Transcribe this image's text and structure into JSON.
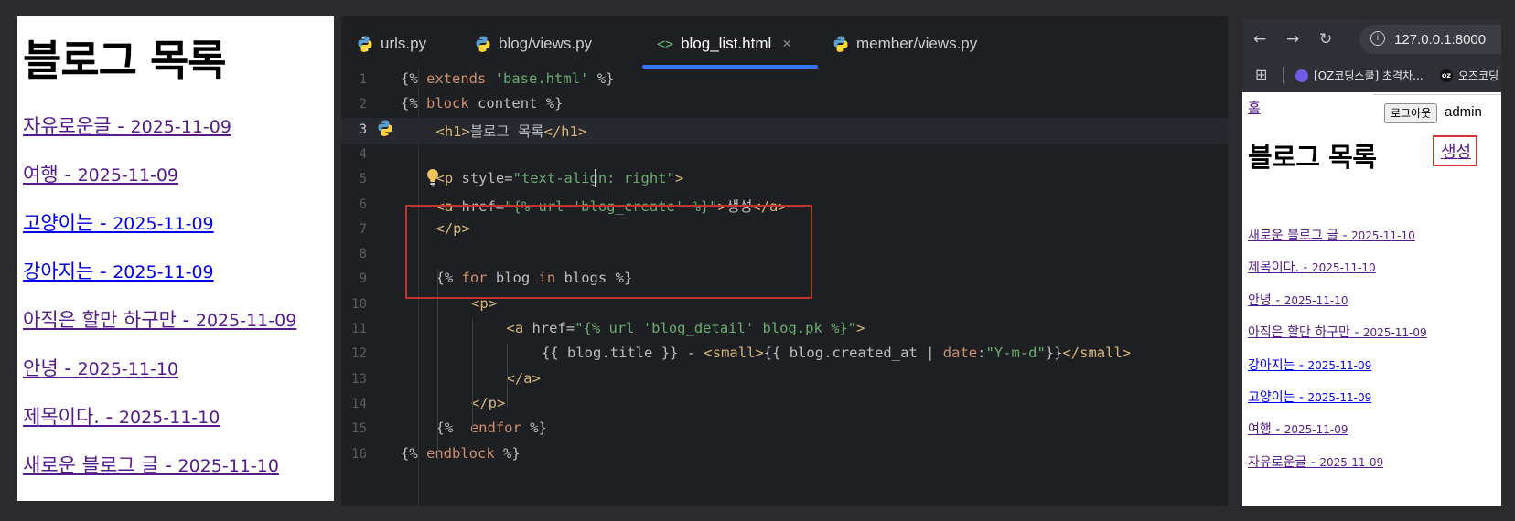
{
  "left_browser": {
    "heading": "블로그 목록",
    "posts": [
      {
        "title": "자유로운글",
        "date": "2025-11-09",
        "visited": true
      },
      {
        "title": "여행",
        "date": "2025-11-09",
        "visited": true
      },
      {
        "title": "고양이는",
        "date": "2025-11-09",
        "visited": false
      },
      {
        "title": "강아지는",
        "date": "2025-11-09",
        "visited": false
      },
      {
        "title": "아직은 할만 하구만",
        "date": "2025-11-09",
        "visited": true
      },
      {
        "title": "안녕",
        "date": "2025-11-10",
        "visited": true
      },
      {
        "title": "제목이다.",
        "date": "2025-11-10",
        "visited": true
      },
      {
        "title": "새로운 블로그 글",
        "date": "2025-11-10",
        "visited": true
      }
    ],
    "separator": " - "
  },
  "editor": {
    "tabs": [
      {
        "label": "urls.py",
        "icon": "python-icon",
        "active": false
      },
      {
        "label": "blog/views.py",
        "icon": "python-icon",
        "active": false
      },
      {
        "label": "blog_list.html",
        "icon": "html-icon",
        "active": true
      },
      {
        "label": "member/views.py",
        "icon": "python-icon",
        "active": false
      }
    ],
    "html_icon_glyph": "<>",
    "close_glyph": "×",
    "current_line": 3,
    "lines": [
      {
        "n": "1",
        "text": "{% extends 'base.html' %}"
      },
      {
        "n": "2",
        "text": "{% block content %}"
      },
      {
        "n": "3",
        "text": "<h1>블로그 목록</h1>"
      },
      {
        "n": "4",
        "text": ""
      },
      {
        "n": "5",
        "text": "<p style=\"text-align: right\">"
      },
      {
        "n": "6",
        "text": "<a href=\"{% url 'blog_create' %}\">생성</a>"
      },
      {
        "n": "7",
        "text": "</p>"
      },
      {
        "n": "8",
        "text": ""
      },
      {
        "n": "9",
        "text": "{% for blog in blogs %}"
      },
      {
        "n": "10",
        "text": "<p>"
      },
      {
        "n": "11",
        "text": "<a href=\"{% url 'blog_detail' blog.pk %}\">"
      },
      {
        "n": "12",
        "text": "{{ blog.title }} - <small>{{ blog.created_at | date:\"Y-m-d\"}}</small>"
      },
      {
        "n": "13",
        "text": "</a>"
      },
      {
        "n": "14",
        "text": "</p>"
      },
      {
        "n": "15",
        "text": "{%  endfor %}"
      },
      {
        "n": "16",
        "text": "{% endblock %}"
      }
    ],
    "colors": {
      "keyword": "#cf8e6d",
      "string": "#6aab73",
      "tag": "#d5b778",
      "highlight_box": "#c0352b",
      "accent": "#3574f0"
    }
  },
  "right_browser": {
    "url": "127.0.0.1:8000",
    "bookmarks": [
      {
        "label": "[OZ코딩스쿨] 초격차...",
        "icon": "oz-school-favicon"
      },
      {
        "label": "오즈코딩",
        "icon": "oz-favicon",
        "badge": "oz"
      }
    ],
    "home_link": "홈",
    "logout_button": "로그아웃",
    "username": "admin",
    "heading": "블로그 목록",
    "create_link": "생성",
    "posts": [
      {
        "title": "새로운 블로그 글",
        "date": "2025-11-10",
        "visited": true
      },
      {
        "title": "제목이다.",
        "date": "2025-11-10",
        "visited": true
      },
      {
        "title": "안녕",
        "date": "2025-11-10",
        "visited": true
      },
      {
        "title": "아직은 할만 하구만",
        "date": "2025-11-09",
        "visited": true
      },
      {
        "title": "강아지는",
        "date": "2025-11-09",
        "visited": false
      },
      {
        "title": "고양이는",
        "date": "2025-11-09",
        "visited": false
      },
      {
        "title": "여행",
        "date": "2025-11-09",
        "visited": true
      },
      {
        "title": "자유로운글",
        "date": "2025-11-09",
        "visited": true
      }
    ]
  }
}
